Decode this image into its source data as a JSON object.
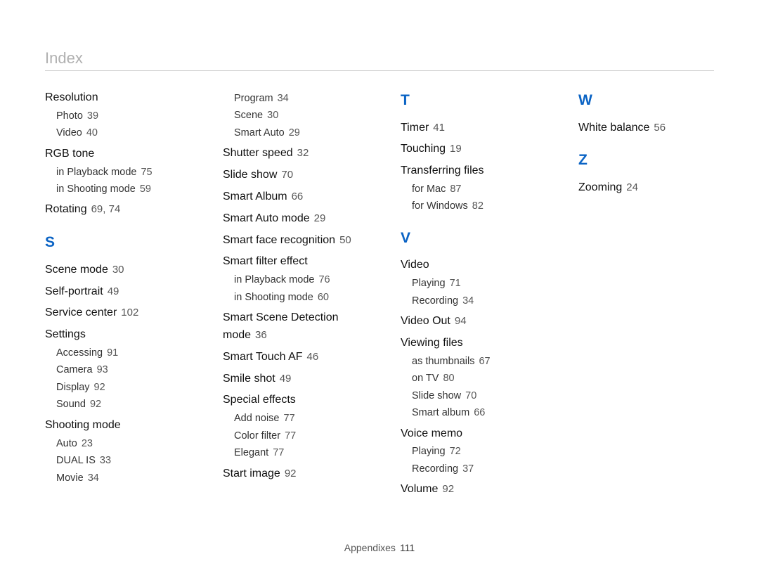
{
  "header": {
    "title": "Index"
  },
  "footer": {
    "label": "Appendixes",
    "page": "111"
  },
  "columns": [
    {
      "items": [
        {
          "type": "topic",
          "title": "Resolution",
          "pages": "",
          "subs": [
            {
              "label": "Photo",
              "pages": "39"
            },
            {
              "label": "Video",
              "pages": "40"
            }
          ]
        },
        {
          "type": "topic",
          "title": "RGB tone",
          "pages": "",
          "subs": [
            {
              "label": "in Playback mode",
              "pages": "75"
            },
            {
              "label": "in Shooting mode",
              "pages": "59"
            }
          ]
        },
        {
          "type": "topic",
          "title": "Rotating",
          "pages": "69, 74",
          "subs": []
        },
        {
          "type": "letter",
          "value": "S"
        },
        {
          "type": "topic",
          "title": "Scene mode",
          "pages": "30",
          "subs": []
        },
        {
          "type": "topic",
          "title": "Self-portrait",
          "pages": "49",
          "subs": []
        },
        {
          "type": "topic",
          "title": "Service center",
          "pages": "102",
          "subs": []
        },
        {
          "type": "topic",
          "title": "Settings",
          "pages": "",
          "subs": [
            {
              "label": "Accessing",
              "pages": "91"
            },
            {
              "label": "Camera",
              "pages": "93"
            },
            {
              "label": "Display",
              "pages": "92"
            },
            {
              "label": "Sound",
              "pages": "92"
            }
          ]
        },
        {
          "type": "topic",
          "title": "Shooting mode",
          "pages": "",
          "subs": [
            {
              "label": "Auto",
              "pages": "23"
            },
            {
              "label": "DUAL IS",
              "pages": "33"
            },
            {
              "label": "Movie",
              "pages": "34"
            }
          ]
        }
      ]
    },
    {
      "items": [
        {
          "type": "sub-only",
          "subs": [
            {
              "label": "Program",
              "pages": "34"
            },
            {
              "label": "Scene",
              "pages": "30"
            },
            {
              "label": "Smart Auto",
              "pages": "29"
            }
          ]
        },
        {
          "type": "topic",
          "title": "Shutter speed",
          "pages": "32",
          "subs": []
        },
        {
          "type": "topic",
          "title": "Slide show",
          "pages": "70",
          "subs": []
        },
        {
          "type": "topic",
          "title": "Smart Album",
          "pages": "66",
          "subs": []
        },
        {
          "type": "topic",
          "title": "Smart Auto mode",
          "pages": "29",
          "subs": []
        },
        {
          "type": "topic",
          "title": "Smart face recognition",
          "pages": "50",
          "subs": []
        },
        {
          "type": "topic",
          "title": "Smart filter effect",
          "pages": "",
          "subs": [
            {
              "label": "in Playback mode",
              "pages": "76"
            },
            {
              "label": "in Shooting mode",
              "pages": "60"
            }
          ]
        },
        {
          "type": "topic",
          "title": "Smart Scene Detection mode",
          "pages": "36",
          "subs": []
        },
        {
          "type": "topic",
          "title": "Smart Touch AF",
          "pages": "46",
          "subs": []
        },
        {
          "type": "topic",
          "title": "Smile shot",
          "pages": "49",
          "subs": []
        },
        {
          "type": "topic",
          "title": "Special effects",
          "pages": "",
          "subs": [
            {
              "label": "Add noise",
              "pages": "77"
            },
            {
              "label": "Color filter",
              "pages": "77"
            },
            {
              "label": "Elegant",
              "pages": "77"
            }
          ]
        },
        {
          "type": "topic",
          "title": "Start image",
          "pages": "92",
          "subs": []
        }
      ]
    },
    {
      "items": [
        {
          "type": "letter",
          "value": "T"
        },
        {
          "type": "topic",
          "title": "Timer",
          "pages": "41",
          "subs": []
        },
        {
          "type": "topic",
          "title": "Touching",
          "pages": "19",
          "subs": []
        },
        {
          "type": "topic",
          "title": "Transferring files",
          "pages": "",
          "subs": [
            {
              "label": "for Mac",
              "pages": "87"
            },
            {
              "label": "for Windows",
              "pages": "82"
            }
          ]
        },
        {
          "type": "letter",
          "value": "V"
        },
        {
          "type": "topic",
          "title": "Video",
          "pages": "",
          "subs": [
            {
              "label": "Playing",
              "pages": "71"
            },
            {
              "label": "Recording",
              "pages": "34"
            }
          ]
        },
        {
          "type": "topic",
          "title": "Video Out",
          "pages": "94",
          "subs": []
        },
        {
          "type": "topic",
          "title": "Viewing files",
          "pages": "",
          "subs": [
            {
              "label": "as thumbnails",
              "pages": "67"
            },
            {
              "label": "on TV",
              "pages": "80"
            },
            {
              "label": "Slide show",
              "pages": "70"
            },
            {
              "label": "Smart album",
              "pages": "66"
            }
          ]
        },
        {
          "type": "topic",
          "title": "Voice memo",
          "pages": "",
          "subs": [
            {
              "label": "Playing",
              "pages": "72"
            },
            {
              "label": "Recording",
              "pages": "37"
            }
          ]
        },
        {
          "type": "topic",
          "title": "Volume",
          "pages": "92",
          "subs": []
        }
      ]
    },
    {
      "items": [
        {
          "type": "letter",
          "value": "W"
        },
        {
          "type": "topic",
          "title": "White balance",
          "pages": "56",
          "subs": []
        },
        {
          "type": "letter",
          "value": "Z"
        },
        {
          "type": "topic",
          "title": "Zooming",
          "pages": "24",
          "subs": []
        }
      ]
    }
  ]
}
